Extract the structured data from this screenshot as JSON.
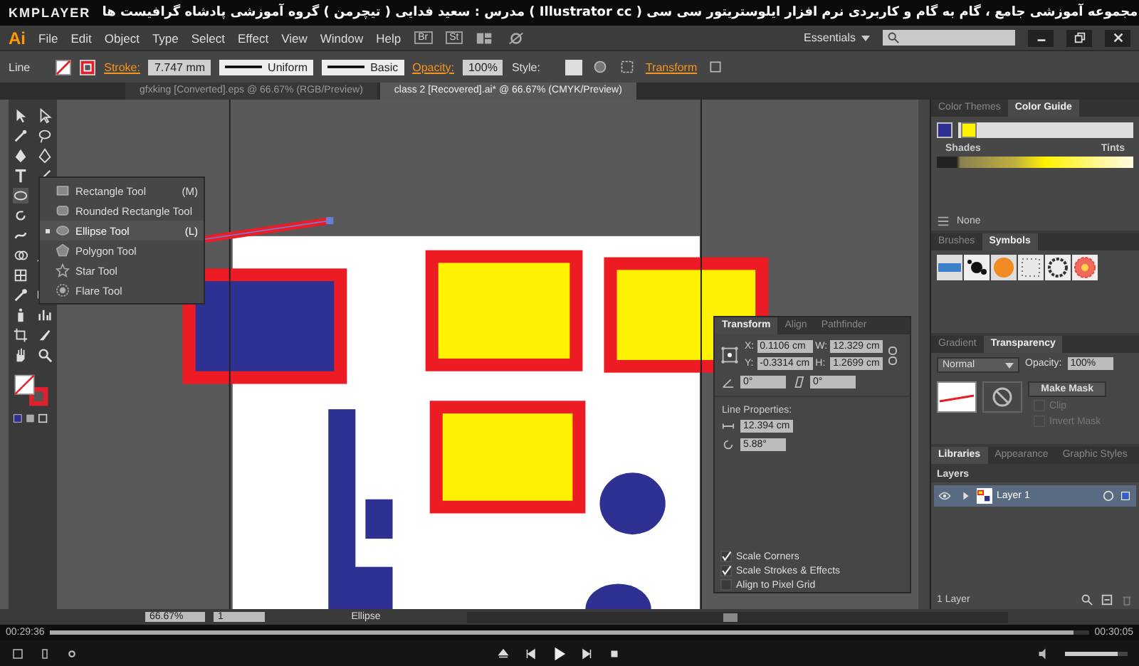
{
  "player": {
    "logo": "KMPLAYER",
    "title": "مجموعه آموزشی جامع ، گام به گام و کاربردی نرم افزار ایلوستریتور سی سی ( Illustrator cc )  مدرس : سعید فدایی ( تیچرمن ) گروه آموزشی پادشاه گرافیست ها",
    "elapsed": "00:29:36",
    "total": "00:30:05",
    "progress": {
      "level": 0.985
    },
    "volume": {
      "level": 0.85
    }
  },
  "app": {
    "logo": "Ai",
    "menu": [
      "File",
      "Edit",
      "Object",
      "Type",
      "Select",
      "Effect",
      "View",
      "Window",
      "Help"
    ],
    "bridge": "Br",
    "stock": "St",
    "workspace": "Essentials"
  },
  "control_bar": {
    "selection": "Line",
    "stroke_label": "Stroke:",
    "stroke_weight": "7.747 mm",
    "profile": "Uniform",
    "brush": "Basic",
    "opacity_label": "Opacity:",
    "opacity": "100%",
    "style_label": "Style:",
    "transform": "Transform"
  },
  "doc_tabs": [
    {
      "label": "gfxking [Converted].eps @ 66.67% (RGB/Preview)",
      "selected": false
    },
    {
      "label": "class 2 [Recovered].ai* @ 66.67% (CMYK/Preview)",
      "selected": true
    }
  ],
  "flyout": [
    {
      "label": "Rectangle Tool",
      "shortcut": "(M)",
      "selected": false
    },
    {
      "label": "Rounded Rectangle Tool",
      "selected": false
    },
    {
      "label": "Ellipse Tool",
      "shortcut": "(L)",
      "selected": true
    },
    {
      "label": "Polygon Tool",
      "selected": false
    },
    {
      "label": "Star Tool",
      "selected": false
    },
    {
      "label": "Flare Tool",
      "selected": false
    }
  ],
  "transform_panel": {
    "tabs": [
      {
        "label": "Transform",
        "selected": true
      },
      {
        "label": "Align",
        "selected": false
      },
      {
        "label": "Pathfinder",
        "selected": false
      }
    ],
    "fields": [
      {
        "label": "X:",
        "value": "0.1106 cm"
      },
      {
        "label": "W:",
        "value": "12.329 cm"
      },
      {
        "label": "Y:",
        "value": "-0.3314 cm"
      },
      {
        "label": "H:",
        "value": "1.2699 cm"
      }
    ],
    "rotate": "0°",
    "shear": "0°",
    "line_heading": "Line Properties:",
    "length": "12.394 cm",
    "angle": "5.88°",
    "options": [
      {
        "label": "Scale Corners",
        "checked": true
      },
      {
        "label": "Scale Strokes & Effects",
        "checked": true
      },
      {
        "label": "Align to Pixel Grid",
        "checked": false
      }
    ]
  },
  "color_guide": {
    "tabs": [
      {
        "label": "Color Themes",
        "selected": false
      },
      {
        "label": "Color Guide",
        "selected": true
      }
    ],
    "shades": "Shades",
    "tints": "Tints",
    "none": "None"
  },
  "symbols": {
    "tabs": [
      {
        "label": "Brushes",
        "selected": false
      },
      {
        "label": "Symbols",
        "selected": true
      }
    ]
  },
  "transparency": {
    "tabs": [
      {
        "label": "Gradient",
        "selected": false
      },
      {
        "label": "Transparency",
        "selected": true
      }
    ],
    "blend": "Normal",
    "opacity_label": "Opacity:",
    "opacity": "100%",
    "make_mask": "Make Mask",
    "options": [
      {
        "label": "Clip",
        "checked": false
      },
      {
        "label": "Invert Mask",
        "checked": false
      }
    ]
  },
  "library_tabs": [
    {
      "label": "Libraries",
      "selected": true
    },
    {
      "label": "Appearance",
      "selected": false
    },
    {
      "label": "Graphic Styles",
      "selected": false
    }
  ],
  "layers": {
    "title": "Layers",
    "rows": [
      {
        "name": "Layer 1",
        "visible": true
      }
    ],
    "count": "1 Layer"
  },
  "status": {
    "zoom": "66.67%",
    "artboard": "1",
    "tool": "Ellipse"
  }
}
